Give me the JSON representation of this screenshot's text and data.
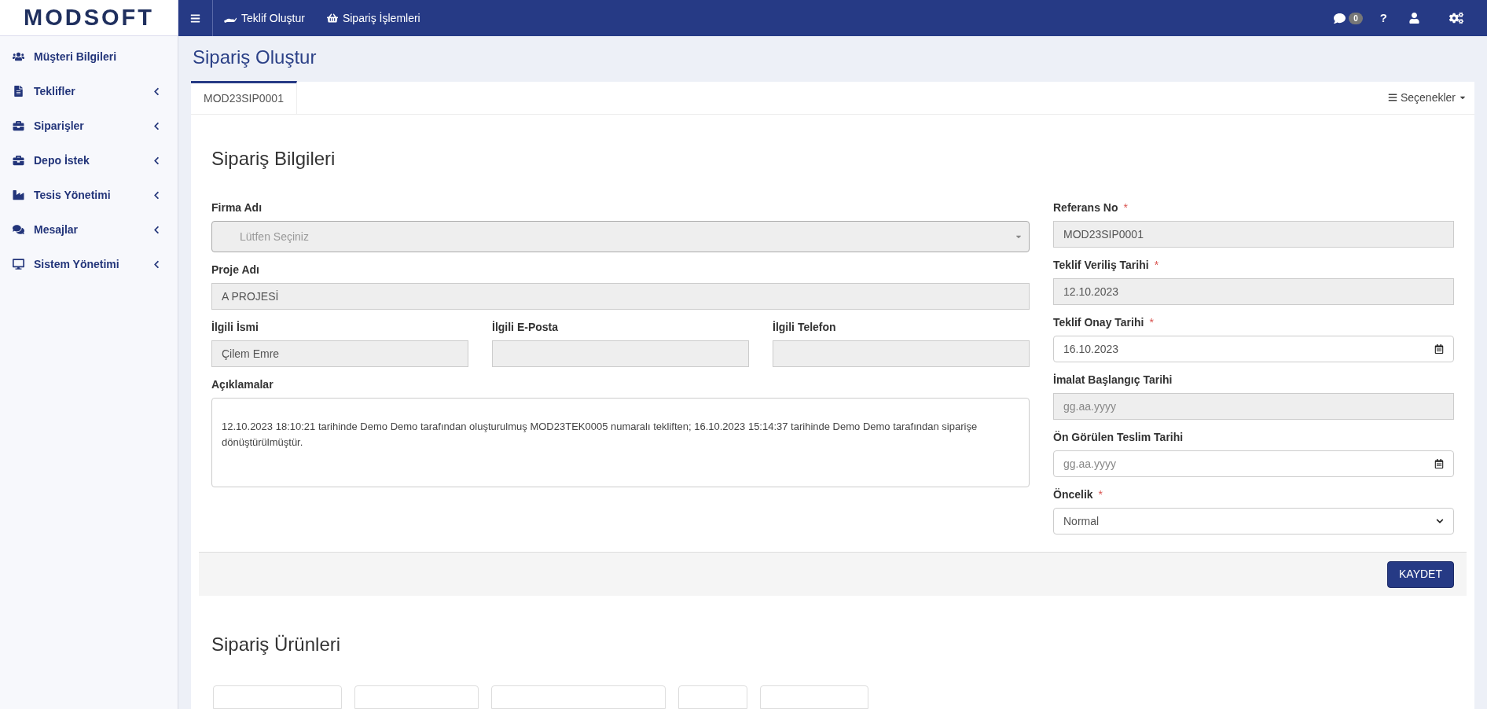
{
  "brand": {
    "logo": "MODSOFT"
  },
  "topbar": {
    "links": [
      {
        "label": "Teklif Oluştur"
      },
      {
        "label": "Sipariş İşlemleri"
      }
    ],
    "message_count": "0",
    "help": "?"
  },
  "sidebar": {
    "items": [
      {
        "label": "Müşteri Bilgileri",
        "has_submenu": false
      },
      {
        "label": "Teklifler",
        "has_submenu": true
      },
      {
        "label": "Siparişler",
        "has_submenu": true
      },
      {
        "label": "Depo İstek",
        "has_submenu": true
      },
      {
        "label": "Tesis Yönetimi",
        "has_submenu": true
      },
      {
        "label": "Mesajlar",
        "has_submenu": true
      },
      {
        "label": "Sistem Yönetimi",
        "has_submenu": true
      }
    ]
  },
  "page_title": "Sipariş Oluştur",
  "tabs": [
    {
      "label": "MOD23SIP0001",
      "selected": true
    }
  ],
  "options_menu": "Seçenekler",
  "section_title": "Sipariş Bilgileri",
  "left_fields": [
    {
      "kind": "select",
      "label": "Firma Adı",
      "placeholder": "Lütfen Seçiniz",
      "disabled": true
    },
    {
      "kind": "text",
      "label": "Proje Adı",
      "value": "A PROJESİ",
      "disabled": true
    }
  ],
  "contact_fields": [
    {
      "kind": "text",
      "label": "İlgili İsmi",
      "value": "Çilem Emre",
      "disabled": true
    },
    {
      "kind": "text",
      "label": "İlgili E-Posta",
      "disabled": true
    },
    {
      "kind": "text",
      "label": "İlgili Telefon",
      "disabled": true
    }
  ],
  "notes": {
    "label": "Açıklamalar",
    "value": "12.10.2023 18:10:21 tarihinde Demo Demo tarafından oluşturulmuş MOD23TEK0005 numaralı tekliften; 16.10.2023 15:14:37 tarihinde Demo Demo tarafından siparişe dönüştürülmüştür."
  },
  "right_fields": [
    {
      "kind": "text",
      "label": "Referans No",
      "required_mark": "*",
      "value": "MOD23SIP0001",
      "disabled": true
    },
    {
      "kind": "text",
      "label": "Teklif Veriliş Tarihi",
      "required_mark": "*",
      "value": "12.10.2023",
      "disabled": true
    },
    {
      "kind": "date",
      "label": "Teklif Onay Tarihi",
      "required_mark": "*",
      "value": "16.10.2023",
      "disabled": false
    },
    {
      "kind": "text",
      "label": "İmalat Başlangıç Tarihi",
      "placeholder": "gg.aa.yyyy",
      "disabled": true
    },
    {
      "kind": "date",
      "label": "Ön Görülen Teslim Tarihi",
      "placeholder": "gg.aa.yyyy",
      "disabled": false
    },
    {
      "kind": "dropdown",
      "label": "Öncelik",
      "required_mark": "*",
      "value": "Normal",
      "disabled": false
    }
  ],
  "save_button": "KAYDET",
  "products_title": "Sipariş Ürünleri"
}
